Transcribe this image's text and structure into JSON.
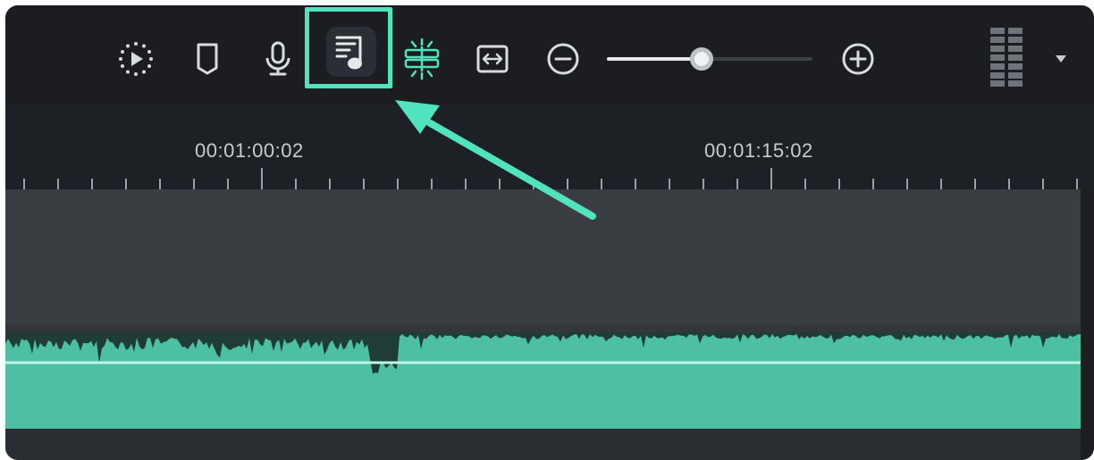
{
  "toolbar": {
    "buttons": [
      {
        "name": "render-preview-icon"
      },
      {
        "name": "marker-icon"
      },
      {
        "name": "microphone-icon"
      },
      {
        "name": "audio-music-icon"
      },
      {
        "name": "snap-split-icon"
      },
      {
        "name": "fit-timeline-icon"
      },
      {
        "name": "zoom-out-icon"
      },
      {
        "name": "zoom-in-icon"
      },
      {
        "name": "track-height-icon"
      },
      {
        "name": "dropdown-arrow-icon"
      }
    ],
    "zoom_level": 0.46,
    "highlight_color": "#51e3bd"
  },
  "ruler": {
    "timecodes": [
      "00:01:00:02",
      "00:01:15:02"
    ]
  },
  "colors": {
    "toolbar_bg": "#1b1d21",
    "audio_clip": "#4dbfa2",
    "accent": "#51e3bd"
  }
}
